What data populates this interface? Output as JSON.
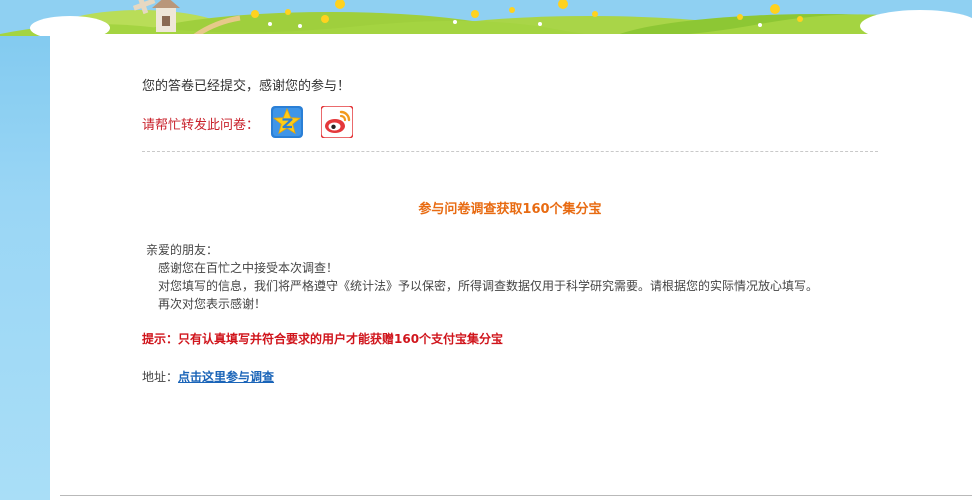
{
  "message": {
    "thanks": "您的答卷已经提交，感谢您的参与！",
    "share_label": "请帮忙转发此问卷："
  },
  "share": [
    {
      "icon": "qzone-icon",
      "color": "#2a7fd6"
    },
    {
      "icon": "weibo-icon",
      "color": "#e4383b"
    }
  ],
  "survey": {
    "subtitle": "参与问卷调查获取160个集分宝",
    "greeting": "亲爱的朋友：",
    "lines": [
      "感谢您在百忙之中接受本次调查！",
      "对您填写的信息，我们将严格遵守《统计法》予以保密，所得调查数据仅用于科学研究需要。请根据您的实际情况放心填写。",
      "再次对您表示感谢！"
    ],
    "tip": "提示：只有认真填写并符合要求的用户才能获赠160个支付宝集分宝",
    "address_label": "地址：",
    "address_link": "点击这里参与调查"
  },
  "colors": {
    "accent_orange": "#e86b12",
    "tip_red": "#d0151c",
    "share_red": "#c8202a",
    "link_blue": "#1a64b8",
    "sky_blue": "#8fd0f2",
    "grass_green": "#9ccc3c"
  }
}
